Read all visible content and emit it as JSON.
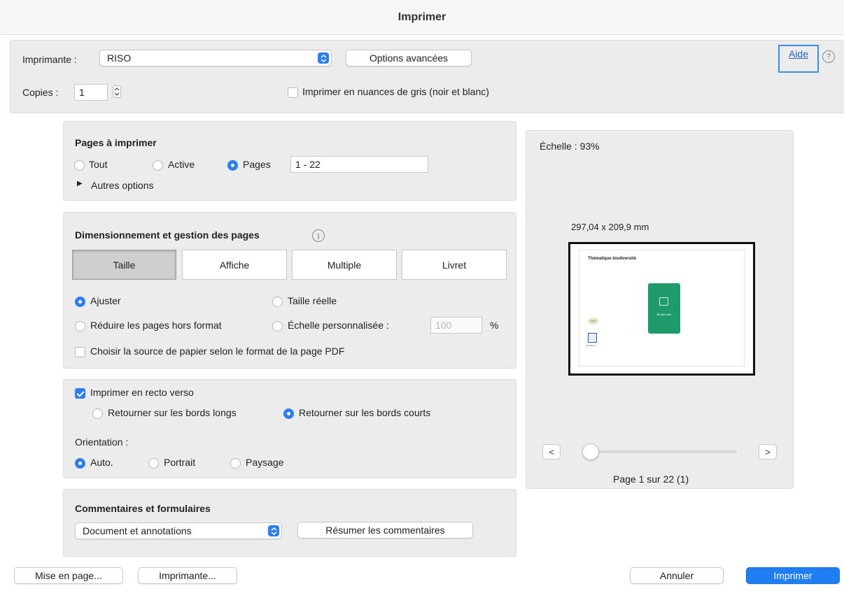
{
  "window": {
    "title": "Imprimer"
  },
  "printer": {
    "label": "Imprimante :",
    "selected": "RISO",
    "advanced_button": "Options avancées",
    "help_link": "Aide",
    "copies_label": "Copies :",
    "copies_value": "1",
    "grayscale_label": "Imprimer en nuances de gris (noir et blanc)",
    "grayscale_checked": false
  },
  "pages_section": {
    "title": "Pages à imprimer",
    "options": [
      "Tout",
      "Active",
      "Pages"
    ],
    "selected": "Pages",
    "range_value": "1 - 22",
    "more_options": "Autres options"
  },
  "sizing_section": {
    "title": "Dimensionnement et gestion des pages",
    "tabs": [
      "Taille",
      "Affiche",
      "Multiple",
      "Livret"
    ],
    "active_tab": "Taille",
    "fit_label": "Ajuster",
    "actual_size_label": "Taille réelle",
    "shrink_label": "Réduire les pages hors format",
    "custom_scale_label": "Échelle personnalisée :",
    "custom_scale_value": "100",
    "custom_scale_unit": "%",
    "paper_source_label": "Choisir la source de papier selon le format de la page PDF",
    "selected": "Ajuster"
  },
  "duplex_section": {
    "duplex_label": "Imprimer en recto verso",
    "duplex_checked": true,
    "long_edge_label": "Retourner sur les bords longs",
    "short_edge_label": "Retourner sur les bords courts",
    "flip_selected": "Retourner sur les bords courts",
    "orientation_label": "Orientation :",
    "orientation_options": [
      "Auto.",
      "Portrait",
      "Paysage"
    ],
    "orientation_selected": "Auto."
  },
  "comments_section": {
    "title": "Commentaires et formulaires",
    "selected": "Document et annotations",
    "summarize_button": "Résumer les commentaires"
  },
  "preview": {
    "scale_text": "Échelle : 93%",
    "page_size": "297,04 x 209,9 mm",
    "doc_heading": "Thématique biodiversité",
    "card_label": "Biodiversité",
    "badge_label": "Label",
    "logo_text": "Eco-École",
    "prev_button": "<",
    "next_button": ">",
    "page_indicator": "Page 1 sur 22 (1)",
    "slider_position": 1
  },
  "footer": {
    "page_setup_button": "Mise en page...",
    "printer_button": "Imprimante...",
    "cancel_button": "Annuler",
    "print_button": "Imprimer"
  },
  "colors": {
    "accent": "#2a7ef7",
    "primary_button": "#1f7ff2",
    "card_green": "#1f9a6a",
    "panel_bg": "#ececec"
  }
}
